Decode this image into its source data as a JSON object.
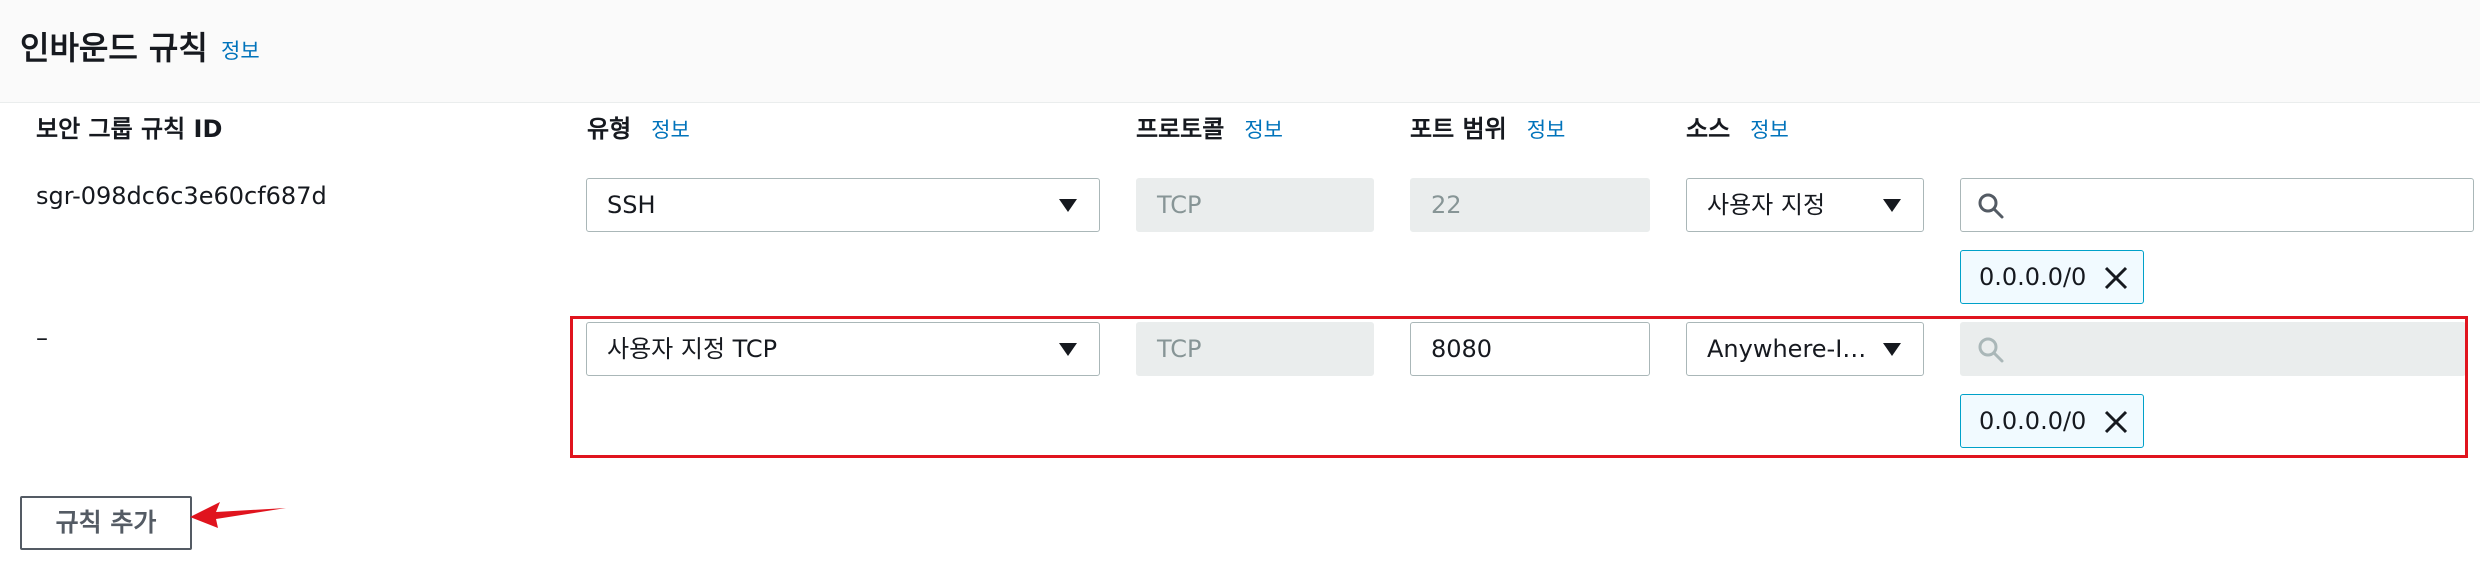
{
  "header": {
    "title": "인바운드 규칙",
    "info": "정보"
  },
  "columns": {
    "rule_id": "보안 그룹 규칙 ID",
    "type": "유형",
    "protocol": "프로토콜",
    "port_range": "포트 범위",
    "source": "소스",
    "info": "정보"
  },
  "rules": [
    {
      "id": "sgr-098dc6c3e60cf687d",
      "type": "SSH",
      "protocol": "TCP",
      "port": "22",
      "source_type": "사용자 지정",
      "cidr": "0.0.0.0/0"
    },
    {
      "id": "–",
      "type": "사용자 지정 TCP",
      "protocol": "TCP",
      "port": "8080",
      "source_type": "Anywhere-I…",
      "cidr": "0.0.0.0/0"
    }
  ],
  "add_rule_button": "규칙 추가",
  "colors": {
    "highlight": "#e0141e",
    "link": "#0073bb",
    "token_border": "#00a1c9"
  },
  "icons": [
    "search-icon",
    "close-icon",
    "caret-down-icon",
    "arrow-annotation"
  ]
}
